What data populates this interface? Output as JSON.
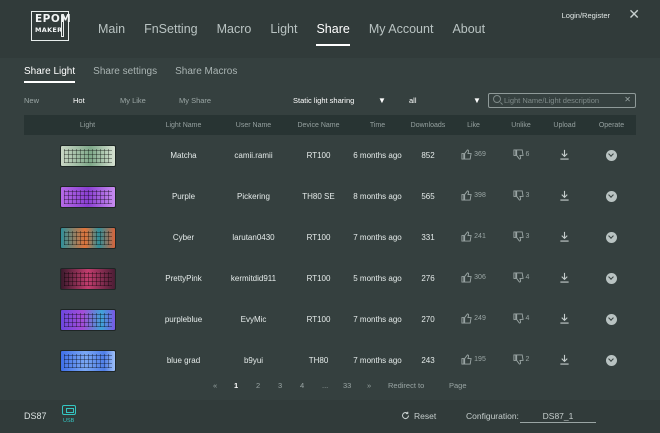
{
  "app": {
    "logo_line1": "EPOM",
    "logo_line2": "MAKER"
  },
  "nav": [
    "Main",
    "FnSetting",
    "Macro",
    "Light",
    "Share",
    "My Account",
    "About"
  ],
  "nav_active": "Share",
  "header": {
    "login": "Login/Register",
    "close": "✕"
  },
  "subtabs": [
    "Share Light",
    "Share settings",
    "Share Macros"
  ],
  "subtab_active": "Share Light",
  "filters": {
    "new": "New",
    "hot": "Hot",
    "my_like": "My Like",
    "my_share": "My Share",
    "type_select": "Static light sharing",
    "model_select": "all",
    "search_placeholder": "Light Name/Light description",
    "search_clear": "✕"
  },
  "table": {
    "headers": [
      "Light",
      "Light Name",
      "User Name",
      "Device Name",
      "Time",
      "Downloads",
      "Like",
      "Unlike",
      "Upload",
      "Operate"
    ],
    "rows": [
      {
        "name": "Matcha",
        "user": "camii.ramii",
        "device": "RT100",
        "time": "6 months ago",
        "downloads": "852",
        "like": "369",
        "unlike": "6"
      },
      {
        "name": "Purple",
        "user": "Pickering",
        "device": "TH80 SE",
        "time": "8 months ago",
        "downloads": "565",
        "like": "398",
        "unlike": "3"
      },
      {
        "name": "Cyber",
        "user": "larutan0430",
        "device": "RT100",
        "time": "7 months ago",
        "downloads": "331",
        "like": "241",
        "unlike": "3"
      },
      {
        "name": "PrettyPink",
        "user": "kermitdid911",
        "device": "RT100",
        "time": "5 months ago",
        "downloads": "276",
        "like": "306",
        "unlike": "4"
      },
      {
        "name": "purpleblue",
        "user": "EvyMic",
        "device": "RT100",
        "time": "7 months ago",
        "downloads": "270",
        "like": "249",
        "unlike": "4"
      },
      {
        "name": "blue grad",
        "user": "b9yui",
        "device": "TH80",
        "time": "7 months ago",
        "downloads": "243",
        "like": "195",
        "unlike": "2"
      }
    ]
  },
  "pagination": {
    "prev": "«",
    "pages": [
      "1",
      "2",
      "3",
      "4",
      "...",
      "33"
    ],
    "current": "1",
    "next": "»",
    "redirect_label": "Redirect to",
    "page_label": "Page"
  },
  "footer": {
    "device": "DS87",
    "usb_label": "USB",
    "reset": "Reset",
    "config_label": "Configuration:",
    "config_value": "DS87_1"
  },
  "colors": {
    "background": "#35403f",
    "header_row": "#283433",
    "usb_accent": "#34c6c2",
    "text_active": "#ffffff"
  },
  "icons": [
    "logo",
    "close-icon",
    "dropdown-arrow-icon",
    "search-icon",
    "thumbs-up-icon",
    "thumbs-down-icon",
    "download-icon",
    "chevron-down-icon",
    "usb-icon",
    "reset-icon"
  ]
}
